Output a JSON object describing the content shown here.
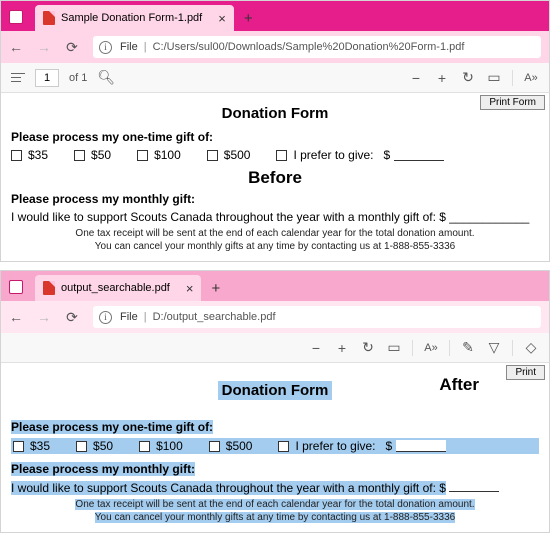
{
  "before": {
    "tab": "Sample Donation Form-1.pdf",
    "fileLabel": "File",
    "url": "C:/Users/sul00/Downloads/Sample%20Donation%20Form-1.pdf",
    "page": "1",
    "of": "of 1",
    "print": "Print Form",
    "title": "Donation Form",
    "prompt1": "Please process my one-time gift of:",
    "opts": {
      "a": "$35",
      "b": "$50",
      "c": "$100",
      "d": "$500",
      "e": "I prefer to give:",
      "dollar": "$"
    },
    "watermark": "Before",
    "prompt2": "Please process my monthly gift:",
    "monthlyText": "I would like to support Scouts Canada throughout the year with a monthly gift of: $ ____________",
    "fine1": "One tax receipt will be sent at the end of each calendar year for the total donation amount.",
    "fine2": "You can cancel your monthly gifts at any time by contacting us at 1-888-855-3336"
  },
  "after": {
    "tab": "output_searchable.pdf",
    "fileLabel": "File",
    "url": "D:/output_searchable.pdf",
    "print": "Print",
    "title": "Donation Form",
    "watermark": "After",
    "prompt1": "Please process my one-time gift of:",
    "opts": {
      "a": "$35",
      "b": "$50",
      "c": "$100",
      "d": "$500",
      "e": "I prefer to give:",
      "dollar": "$"
    },
    "prompt2": "Please process my monthly gift:",
    "monthlyText": "I would like to support Scouts Canada throughout the year with a monthly gift of: $",
    "fine1": "One tax receipt will be sent at the end of each calendar year for the total donation amount.",
    "fine2": "You can cancel your monthly gifts at any time by contacting us at 1-888-855-3336"
  }
}
